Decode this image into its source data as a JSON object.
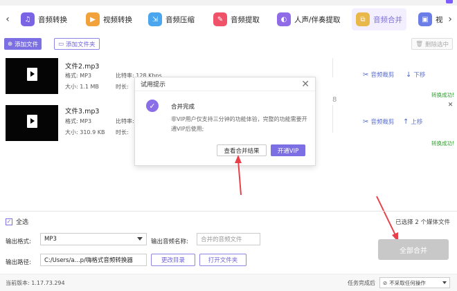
{
  "tabs": [
    {
      "label": "音频转换",
      "icon": "music-icon",
      "color": "#7b63e6"
    },
    {
      "label": "视频转换",
      "icon": "video-icon",
      "color": "#f2a23a"
    },
    {
      "label": "音频压缩",
      "icon": "compress-icon",
      "color": "#4aa6ef"
    },
    {
      "label": "音频提取",
      "icon": "mic-icon",
      "color": "#f0526a"
    },
    {
      "label": "人声/伴奏提取",
      "icon": "voice-icon",
      "color": "#8f6be8"
    },
    {
      "label": "音频合并",
      "icon": "merge-icon",
      "color": "#e8b84a"
    },
    {
      "label": "视",
      "icon": "video-clip-icon",
      "color": "#6b7ee8"
    }
  ],
  "toolbar": {
    "add_file": "添加文件",
    "add_folder": "添加文件夹",
    "delete_selected": "删除选中"
  },
  "files": [
    {
      "name": "文件2.mp3",
      "format_label": "格式:",
      "format": "MP3",
      "size_label": "大小:",
      "size": "1.1 MB",
      "bitrate_label": "比特率:",
      "bitrate": "128 Kbps",
      "duration_label": "时长:",
      "cut_label": "音频裁剪",
      "move_label": "下移",
      "status": "转换成功!"
    },
    {
      "name": "文件3.mp3",
      "format_label": "格式:",
      "format": "MP3",
      "size_label": "大小:",
      "size": "310.9 KB",
      "bitrate_label": "比特率:",
      "duration_label": "时长:",
      "cut_label": "音频裁剪",
      "move_label": "上移",
      "status": "转换成功!"
    }
  ],
  "dialog": {
    "title": "试用提示",
    "heading": "合并完成",
    "message": "非VIP用户仅支持三分钟的功能体验，完整的功能需要开通VIP后使用;",
    "view_result": "查看合并结果",
    "open_vip": "开通VIP"
  },
  "bottom": {
    "select_all": "全选",
    "selected_count": "已选择 2 个媒体文件",
    "output_format_label": "输出格式:",
    "output_format": "MP3",
    "output_name_label": "输出音频名称:",
    "output_name_placeholder": "合并的音频文件",
    "output_path_label": "输出路径:",
    "output_path": "C:/Users/a...p/嗨格式音频转换器",
    "change_dir": "更改目录",
    "open_folder": "打开文件夹",
    "merge_all": "全部合并"
  },
  "status": {
    "version_label": "当前版本:",
    "version": "1.17.73.294",
    "after_task_label": "任务完成后",
    "after_task_value": "不采取任何操作"
  },
  "colors": {
    "accent": "#7b6fe3",
    "success": "#2aa02a",
    "arrow": "#e8404a",
    "disabled": "#c8c8c8"
  }
}
